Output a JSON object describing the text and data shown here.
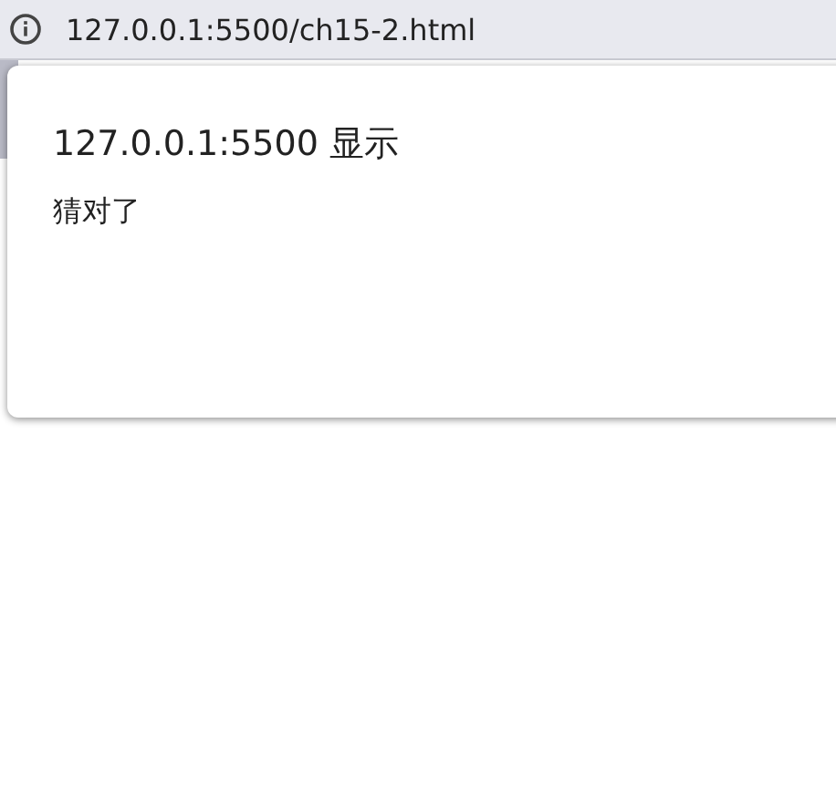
{
  "address_bar": {
    "url": "127.0.0.1:5500/ch15-2.html"
  },
  "dialog": {
    "title": "127.0.0.1:5500 显示",
    "message": "猜对了"
  }
}
